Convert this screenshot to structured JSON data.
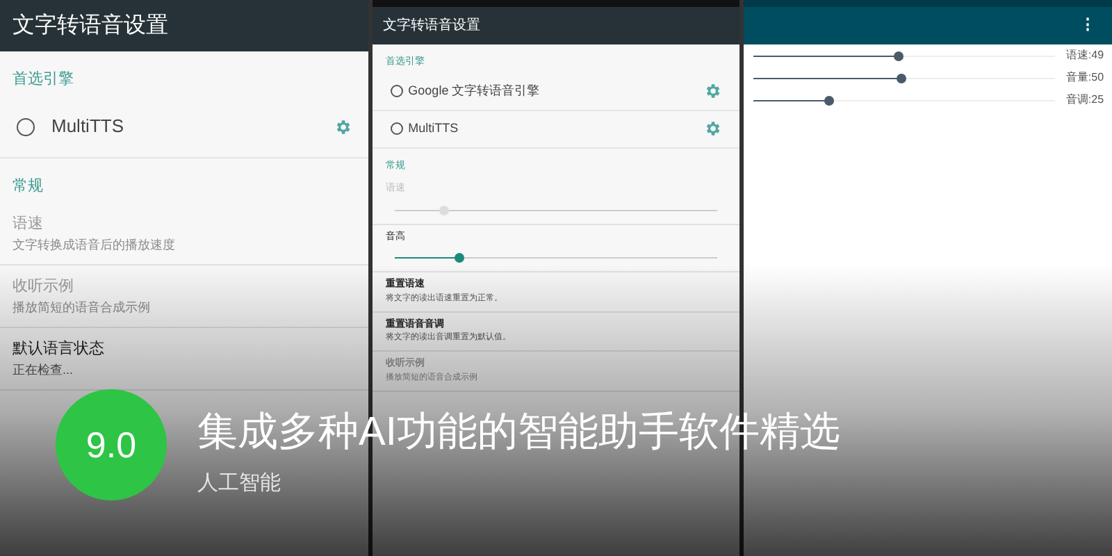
{
  "screens": [
    {
      "kind": "settings",
      "title": "文字转语音设置",
      "sections": [
        {
          "header": "首选引擎",
          "items": [
            {
              "kind": "engine",
              "label": "MultiTTS",
              "selected": false
            }
          ]
        },
        {
          "header": "常规",
          "items": [
            {
              "kind": "pref",
              "title": "语速",
              "summary": "文字转换成语音后的播放速度",
              "disabled": true
            },
            {
              "kind": "pref",
              "title": "收听示例",
              "summary": "播放简短的语音合成示例",
              "disabled": true
            },
            {
              "kind": "pref",
              "title": "默认语言状态",
              "summary": "正在检查...",
              "disabled": false
            }
          ]
        }
      ]
    },
    {
      "kind": "settings",
      "title": "文字转语音设置",
      "sections": [
        {
          "header": "首选引擎",
          "items": [
            {
              "kind": "engine",
              "label": "Google 文字转语音引擎",
              "selected": false
            },
            {
              "kind": "engine",
              "label": "MultiTTS",
              "selected": false
            }
          ]
        },
        {
          "header": "常规",
          "items": [
            {
              "kind": "slider",
              "title": "语速",
              "level": 0.15,
              "disabled": true
            },
            {
              "kind": "slider",
              "title": "音高",
              "level": 0.2,
              "disabled": false
            },
            {
              "kind": "pref",
              "title": "重置语速",
              "summary": "将文字的读出语速重置为正常。",
              "disabled": false
            },
            {
              "kind": "pref",
              "title": "重置语音音调",
              "summary": "将文字的读出音调重置为默认值。",
              "disabled": false
            },
            {
              "kind": "pref",
              "title": "收听示例",
              "summary": "播放简短的语音合成示例",
              "disabled": true
            }
          ]
        }
      ]
    },
    {
      "kind": "sliders",
      "menu": "⋮",
      "sliders": [
        {
          "label": "语速:49",
          "level": 0.48
        },
        {
          "label": "音量:50",
          "level": 0.49
        },
        {
          "label": "音调:25",
          "level": 0.25
        }
      ]
    }
  ],
  "score": "9.0",
  "headline": "集成多种AI功能的智能助手软件精选",
  "category": "人工智能"
}
